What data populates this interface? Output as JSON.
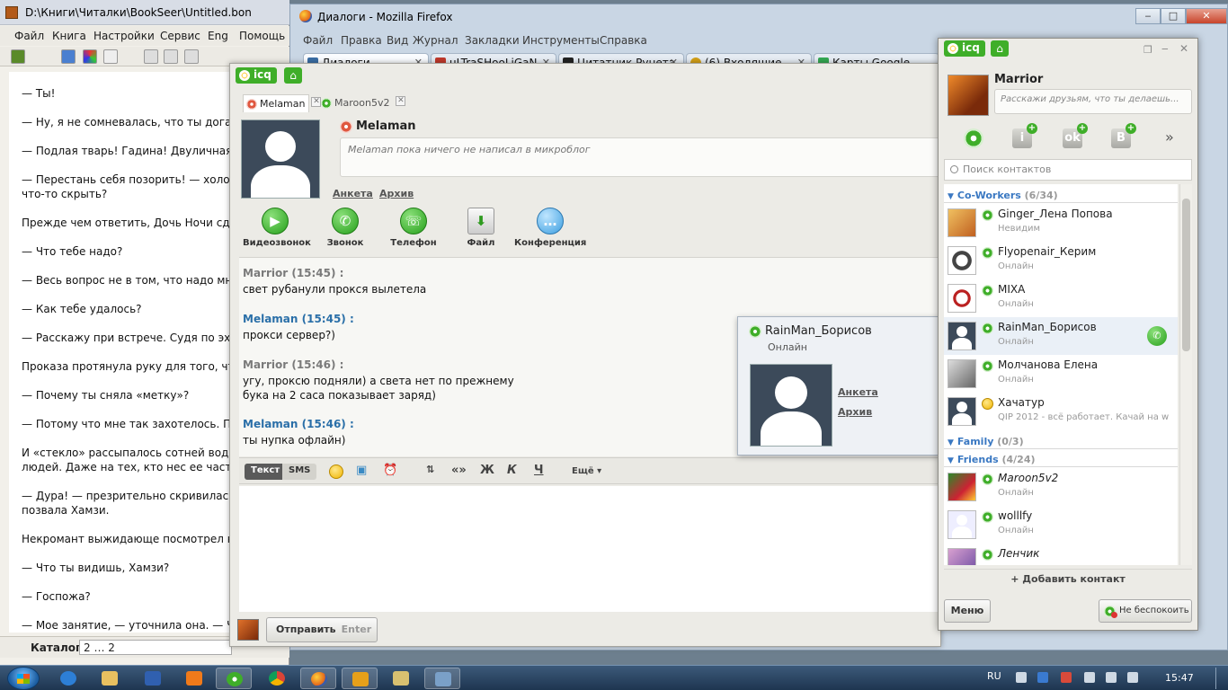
{
  "bookseer": {
    "title": "D:\\Книги\\Читалки\\BookSeer\\Untitled.bon",
    "menu": [
      "Файл",
      "Книга",
      "Настройки",
      "Сервис",
      "Eng",
      "Помощь"
    ],
    "paragraphs": [
      "— Ты!",
      "— Ну, я не сомневалась, что ты догад",
      "— Подлая тварь! Гадина! Двуличная в",
      "— Перестань себя позорить! — холод",
      "что-то скрыть?",
      "Прежде чем ответить, Дочь Ночи сдел",
      "— Что тебе надо?",
      "— Весь вопрос не в том, что надо мне",
      "— Как тебе удалось?",
      "— Расскажу при встрече. Судя по эху",
      "Проказа протянула руку для того, чтоб",
      "— Почему ты сняла «метку»?",
      "— Потому что мне так захотелось. Пос",
      "И «стекло» рассыпалось сотней водян",
      "людей. Даже на тех, кто нес ее частич",
      "— Дура! — презрительно скривилась",
      "позвала Хамзи.",
      "Некромант выжидающе посмотрел на",
      "— Что ты видишь, Хамзи?",
      "— Госпожа?",
      "— Мое занятие, — уточнила она. — Ч"
    ],
    "status_label": "Каталог:",
    "status_value": "2 … 2"
  },
  "firefox": {
    "title": "Диалоги - Mozilla Firefox",
    "menu": [
      "Файл",
      "Правка",
      "Вид",
      "Журнал",
      "Закладки",
      "Инструменты",
      "Справка"
    ],
    "tabs": [
      {
        "label": "Диалоги",
        "color": "#3a6ea5"
      },
      {
        "label": "uLTraSHooLiGaN",
        "color": "#c0392b"
      },
      {
        "label": "Цитатник Рунета",
        "color": "#222222"
      },
      {
        "label": "(6) Входящие - ...",
        "color": "#d4a017"
      },
      {
        "label": "Карты Google",
        "color": "#34a853"
      }
    ]
  },
  "chat": {
    "badge": "icq",
    "tabs": [
      "Melaman",
      "Maroon5v2"
    ],
    "contact_name": "Melaman",
    "microblog": "Melaman пока ничего не написал в микроблог",
    "link_profile": "Анкета",
    "link_archive": "Архив",
    "actions": [
      "Видеозвонок",
      "Звонок",
      "Телефон",
      "Файл",
      "Конференция"
    ],
    "messages": [
      {
        "from": "Marrior (15:45) :",
        "mine": true,
        "lines": [
          "свет рубанули прокся вылетела"
        ]
      },
      {
        "from": "Melaman (15:45) :",
        "mine": false,
        "lines": [
          "прокси сервер?)"
        ]
      },
      {
        "from": "Marrior (15:46) :",
        "mine": true,
        "lines": [
          "угу, проксю подняли) а света нет по прежнему",
          "бука на 2 саса показывает заряд)"
        ]
      },
      {
        "from": "Melaman (15:46) :",
        "mine": false,
        "lines": [
          "ты нупка офлайн)"
        ]
      }
    ],
    "mode_text": "Текст",
    "mode_sms": "SMS",
    "fmt_more": "Ещё",
    "send_label": "Отправить",
    "send_key": "Enter"
  },
  "popup": {
    "name": "RainMan_Борисов",
    "status": "Онлайн",
    "link_profile": "Анкета",
    "link_archive": "Архив"
  },
  "contacts": {
    "badge": "icq",
    "me_name": "Marrior",
    "me_status_placeholder": "Расскажи друзьям, что ты делаешь...",
    "search_placeholder": "Поиск контактов",
    "groups": [
      {
        "name": "Co-Workers",
        "count": "(6/34)"
      },
      {
        "name": "Family",
        "count": "(0/3)"
      },
      {
        "name": "Friends",
        "count": "(4/24)"
      }
    ],
    "coworkers": [
      {
        "name": "Ginger_Лена Попова",
        "status": "Невидим"
      },
      {
        "name": "Flyopenair_Керим",
        "status": "Онлайн"
      },
      {
        "name": "MIXA",
        "status": "Онлайн"
      },
      {
        "name": "RainMan_Борисов",
        "status": "Онлайн"
      },
      {
        "name": "Молчанова Елена",
        "status": "Онлайн"
      },
      {
        "name": "Хачатур",
        "status": "QIP 2012 - всё работает. Качай на w"
      }
    ],
    "friends": [
      {
        "name": "Maroon5v2",
        "status": "Онлайн"
      },
      {
        "name": "wolllfy",
        "status": "Онлайн"
      },
      {
        "name": "Ленчик",
        "status": ""
      }
    ],
    "add_contact": "+ Добавить контакт",
    "menu_label": "Меню",
    "dnd_label": "Не беспокоить"
  },
  "taskbar": {
    "lang": "RU",
    "time": "15:47"
  }
}
